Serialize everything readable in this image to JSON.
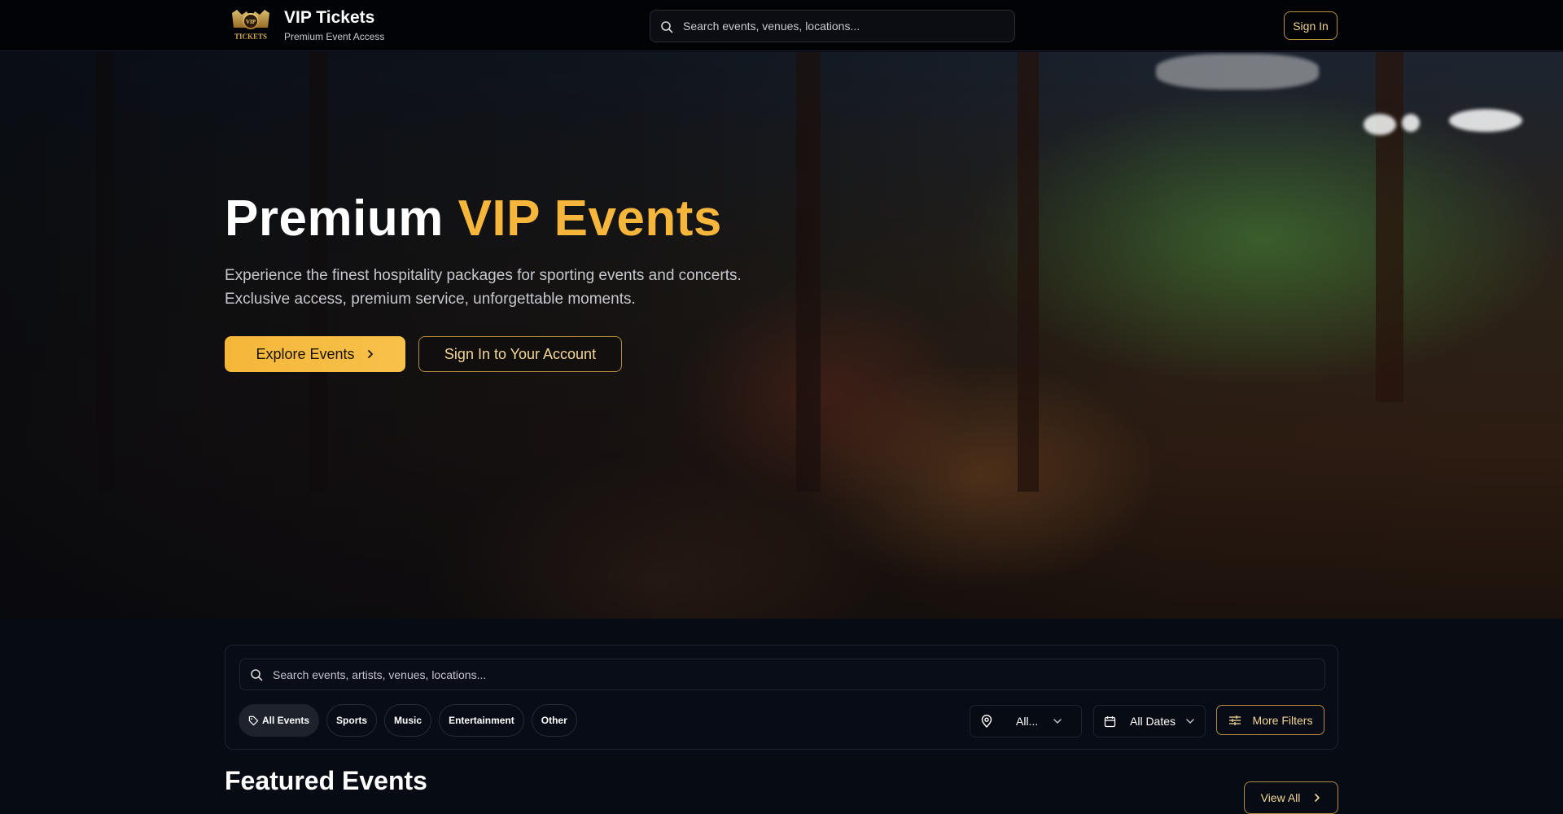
{
  "header": {
    "brand_title": "VIP Tickets",
    "brand_subtitle": "Premium Event Access",
    "logo_text": "VIP TICKETS",
    "search_placeholder": "Search events, venues, locations...",
    "signin_label": "Sign In"
  },
  "hero": {
    "title_main": "Premium",
    "title_accent": "VIP Events",
    "description_line1": "Experience the finest hospitality packages for sporting events and concerts.",
    "description_line2": "Exclusive access, premium service, unforgettable moments.",
    "explore_label": "Explore Events",
    "account_label": "Sign In to Your Account"
  },
  "filters": {
    "search_placeholder": "Search events, artists, venues, locations...",
    "categories": [
      {
        "label": "All Events",
        "active": true
      },
      {
        "label": "Sports",
        "active": false
      },
      {
        "label": "Music",
        "active": false
      },
      {
        "label": "Entertainment",
        "active": false
      },
      {
        "label": "Other",
        "active": false
      }
    ],
    "location_value": "All...",
    "date_value": "All Dates",
    "more_filters_label": "More Filters"
  },
  "featured": {
    "title": "Featured Events",
    "view_all_label": "View All"
  },
  "colors": {
    "accent": "#f6b63c",
    "gold_border": "#b48d42",
    "background": "#070b14"
  }
}
